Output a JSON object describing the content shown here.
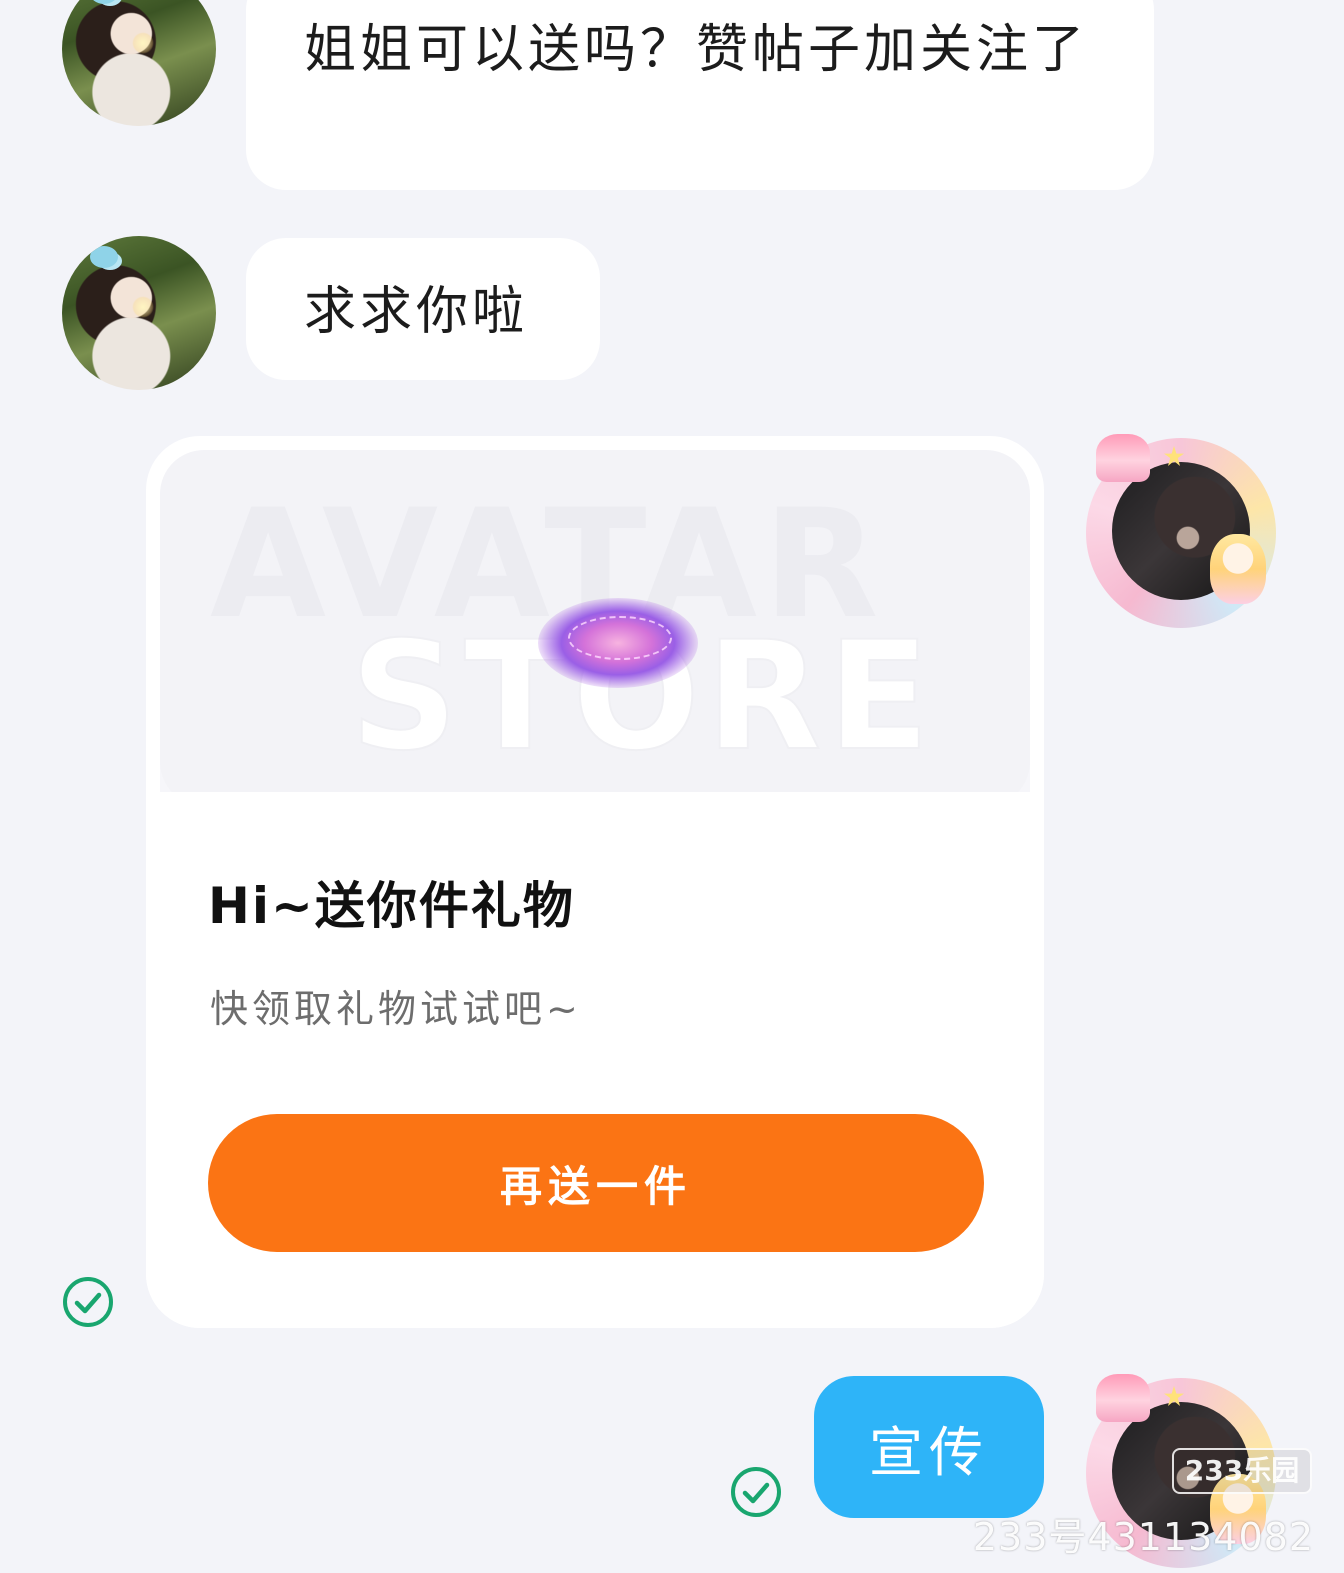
{
  "messages": {
    "incoming_1": "姐姐可以送吗？赞帖子加关注了",
    "incoming_2": "求求你啦"
  },
  "gift_card": {
    "watermark_line_1": "AVATAR",
    "watermark_line_2": "STORE",
    "title": "Hi~送你件礼物",
    "subtitle": "快领取礼物试试吧~",
    "button_label": "再送一件"
  },
  "outgoing": {
    "message": "宣传"
  },
  "source_watermark": {
    "logo": "233乐园",
    "id_text": "233号431134082"
  },
  "colors": {
    "background": "#f3f4f9",
    "button": "#fb7414",
    "outgoing_bubble": "#2eb4f8",
    "check": "#19a66f"
  },
  "icons": {
    "read_status": "check-circle-icon"
  }
}
